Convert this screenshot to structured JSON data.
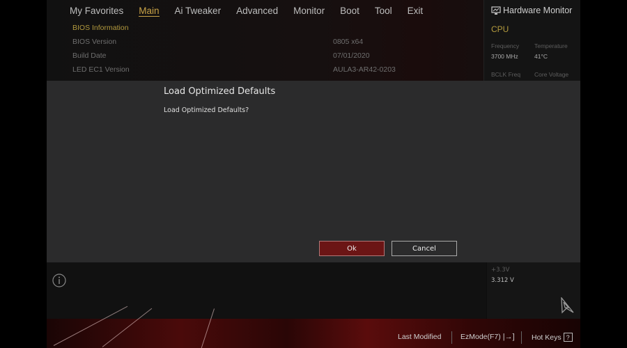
{
  "nav": {
    "tabs": [
      "My Favorites",
      "Main",
      "Ai Tweaker",
      "Advanced",
      "Monitor",
      "Boot",
      "Tool",
      "Exit"
    ],
    "active": "Main"
  },
  "main": {
    "section": "BIOS Information",
    "rows": [
      {
        "label": "BIOS Version",
        "value": "0805  x64"
      },
      {
        "label": "Build Date",
        "value": "07/01/2020"
      },
      {
        "label": "LED EC1 Version",
        "value": "AULA3-AR42-0203"
      }
    ]
  },
  "hardware_monitor": {
    "title": "Hardware Monitor",
    "icon": "monitor-icon",
    "cpu": "CPU",
    "frequency_label": "Frequency",
    "frequency": "3700 MHz",
    "temperature_label": "Temperature",
    "temperature": "41°C",
    "bclk_label": "BCLK Freq",
    "core_voltage_label": "Core Voltage",
    "v33_label": "+3.3V",
    "v33": "3.312 V"
  },
  "dialog": {
    "title": "Load Optimized Defaults",
    "message": "Load Optimized Defaults?",
    "ok": "Ok",
    "cancel": "Cancel"
  },
  "footer": {
    "last_modified": "Last Modified",
    "ezmode": "EzMode(F7)",
    "hotkeys": "Hot Keys",
    "hotkeys_key": "?"
  },
  "colors": {
    "accent": "#c9a347",
    "ok_button": "#6b1515"
  }
}
